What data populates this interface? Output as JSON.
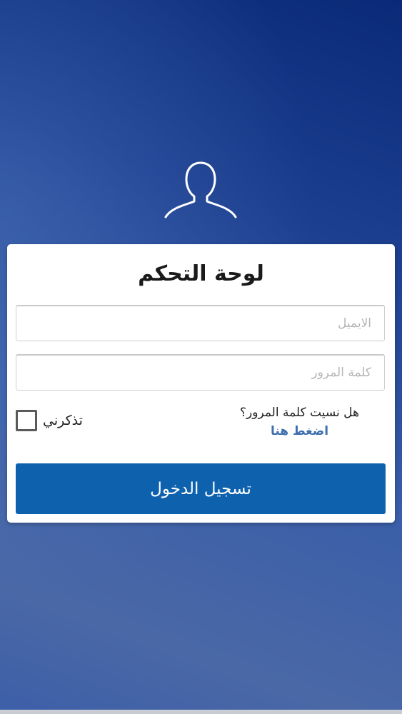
{
  "header": {
    "avatar_icon": "user-outline-icon"
  },
  "login_card": {
    "title": "لوحة التحكم",
    "email_placeholder": "الايميل",
    "email_value": "",
    "password_placeholder": "كلمة المرور",
    "password_value": "",
    "remember_me_label": "تذكرني",
    "remember_me_checked": false,
    "forgot_question": "هل نسيت كلمة المرور؟",
    "forgot_link": "اضغط هنا",
    "login_button_label": "تسجيل الدخول"
  },
  "colors": {
    "background_top": "#0a2a78",
    "background_bottom": "#4a68a6",
    "button": "#0e62ad",
    "link": "#3f6fae",
    "card": "#ffffff"
  }
}
